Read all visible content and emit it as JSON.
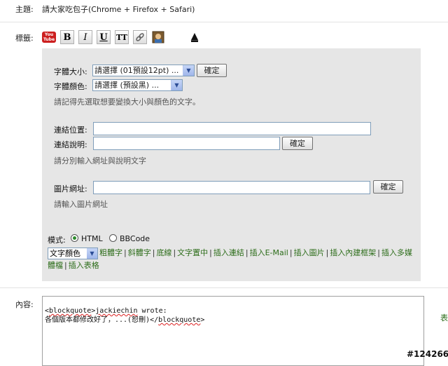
{
  "subject": {
    "label": "主題:",
    "value": "請大家吃包子(Chrome + Firefox + Safari)"
  },
  "tags": {
    "label": "標籤:"
  },
  "toolbar": {
    "youtube_label": "You Tube",
    "bold": "B",
    "italic": "I",
    "underline": "U",
    "font": "TT",
    "link_icon": "link-icon",
    "image_icon": "image-icon",
    "toggle": "▲"
  },
  "font_section": {
    "size_label": "字體大小:",
    "size_value": "請選擇 (01預設12pt) ...",
    "confirm": "確定",
    "color_label": "字體顏色:",
    "color_value": "請選擇 (預設黑) ...",
    "hint": "請記得先選取想要變換大小與顏色的文字。"
  },
  "link_section": {
    "url_label": "連結位置:",
    "desc_label": "連結說明:",
    "confirm": "確定",
    "hint": "請分別輸入網址與說明文字"
  },
  "image_section": {
    "url_label": "圖片網址:",
    "confirm": "確定",
    "hint": "請輸入圖片網址"
  },
  "mode": {
    "label": "模式:",
    "html": "HTML",
    "bbcode": "BBCode",
    "selected": "HTML"
  },
  "insert_bar": {
    "select_value": "文字顏色",
    "links": [
      "粗體字",
      "斜體字",
      "底線",
      "文字置中",
      "插入連結",
      "插入E-Mail",
      "插入圖片",
      "插入內建框架",
      "插入多媒體檔",
      "插入表格"
    ]
  },
  "content": {
    "label": "內容:",
    "line1_a": "<",
    "line1_b": "blockquote",
    "line1_c": ">",
    "line1_d": "jackiechin",
    "line1_e": " wrote:",
    "line2_a": "各個版本都修改好了，...(恕刪)</",
    "line2_b": "blockquote",
    "line2_c": ">"
  },
  "side_text": "表",
  "watermark": "#124266",
  "colors": {
    "panel_bg": "#e6e6e6",
    "link_green": "#2d6d1a"
  }
}
